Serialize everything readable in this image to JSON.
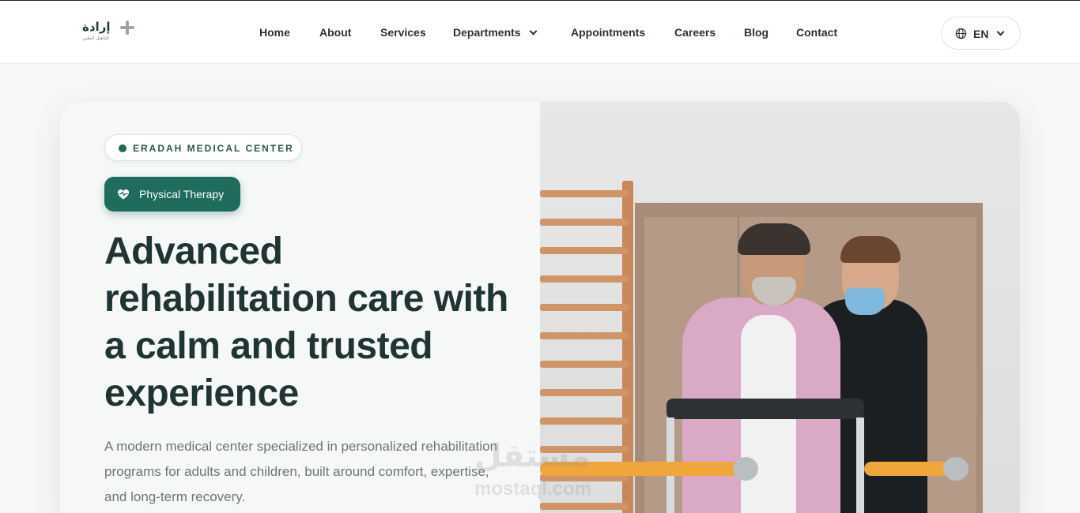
{
  "header": {
    "logo": {
      "ar_text": "إرادة",
      "sub_text": "للتأهيل الطبي"
    },
    "nav": [
      {
        "label": "Home"
      },
      {
        "label": "About"
      },
      {
        "label": "Services"
      },
      {
        "label": "Departments"
      },
      {
        "label": "Appointments"
      },
      {
        "label": "Careers"
      },
      {
        "label": "Blog"
      },
      {
        "label": "Contact"
      }
    ],
    "language": {
      "label": "EN",
      "icon": "globe-icon"
    }
  },
  "hero": {
    "eyebrow": "ERADAH MEDICAL CENTER",
    "badge": {
      "label": "Physical Therapy",
      "icon": "heart-pulse-icon"
    },
    "headline": "Advanced rehabilitation care with a calm and trusted experience",
    "description": "A modern medical center specialized in personalized rehabilitation programs for adults and children, built around comfort, expertise, and long-term recovery."
  },
  "watermark": {
    "text": "مستقل",
    "sub": "mostaql.com"
  },
  "colors": {
    "accent": "#1f6b5e",
    "heading": "#1f3533",
    "body_text": "#6f7574"
  }
}
